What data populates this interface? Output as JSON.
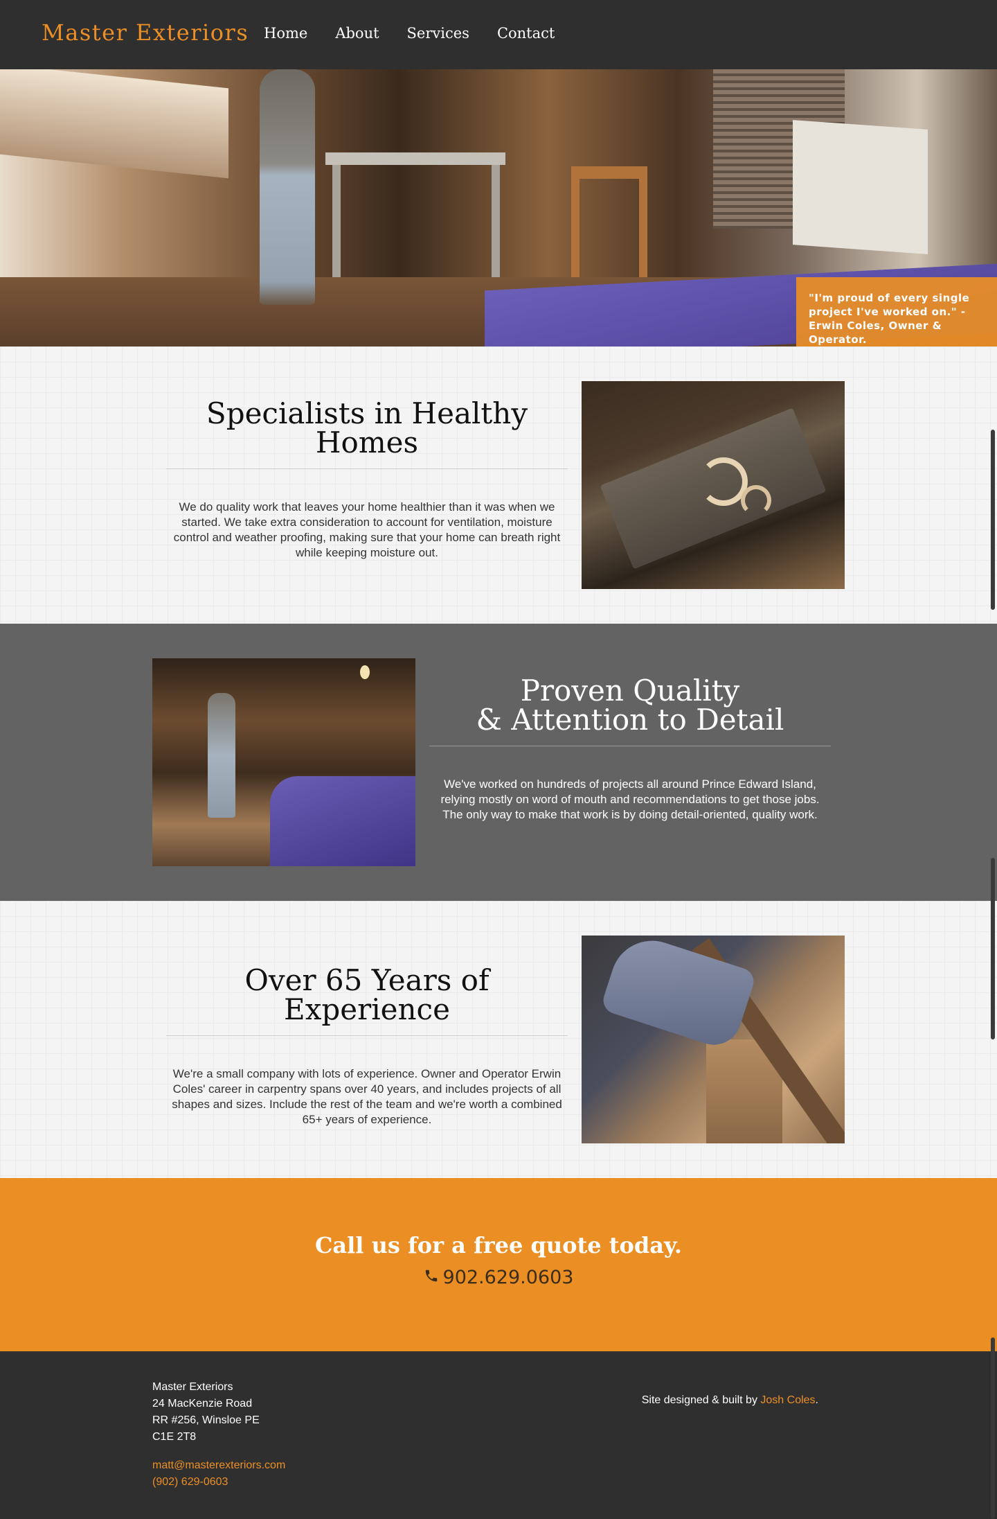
{
  "nav": {
    "brand": "Master Exteriors",
    "links": [
      "Home",
      "About",
      "Services",
      "Contact"
    ]
  },
  "hero": {
    "quote": "\"I'm proud of every single project I've worked on.\" - Erwin Coles, Owner & Operator.",
    "slides": 2,
    "active_slide": 2
  },
  "sections": [
    {
      "title_line1": "Specialists in Healthy",
      "title_line2": "Homes",
      "body": "We do quality work that leaves your home healthier than it was when we started. We take extra consideration to account for ventilation, moisture control and weather proofing, making sure that your home can breath right while keeping moisture out."
    },
    {
      "title_line1": "Proven Quality",
      "title_line2": "& Attention to Detail",
      "body": "We've worked on hundreds of projects all around Prince Edward Island, relying mostly on word of mouth and recommendations to get those jobs. The only way to make that work is by doing detail-oriented, quality work."
    },
    {
      "title_line1": "Over 65 Years of Experience",
      "title_line2": "",
      "body": "We're a small company with lots of experience. Owner and Operator Erwin Coles' career in carpentry spans over 40 years, and includes projects of all shapes and sizes. Include the rest of the team and we're worth a combined 65+ years of experience."
    }
  ],
  "cta": {
    "title": "Call us for a free quote today.",
    "phone_icon": "phone-icon",
    "phone": "902.629.0603"
  },
  "footer": {
    "company": "Master Exteriors",
    "street": "24 MacKenzie Road",
    "box": "RR #256, Winsloe PE",
    "postal": "C1E 2T8",
    "email": "matt@masterexteriors.com",
    "phone": "(902) 629-0603",
    "credit_prefix": "Site designed & built by ",
    "credit_name": "Josh Coles",
    "credit_suffix": "."
  },
  "colors": {
    "accent": "#ec8f26",
    "nav_bg": "#2f2f2f",
    "dark_section": "#636363"
  }
}
